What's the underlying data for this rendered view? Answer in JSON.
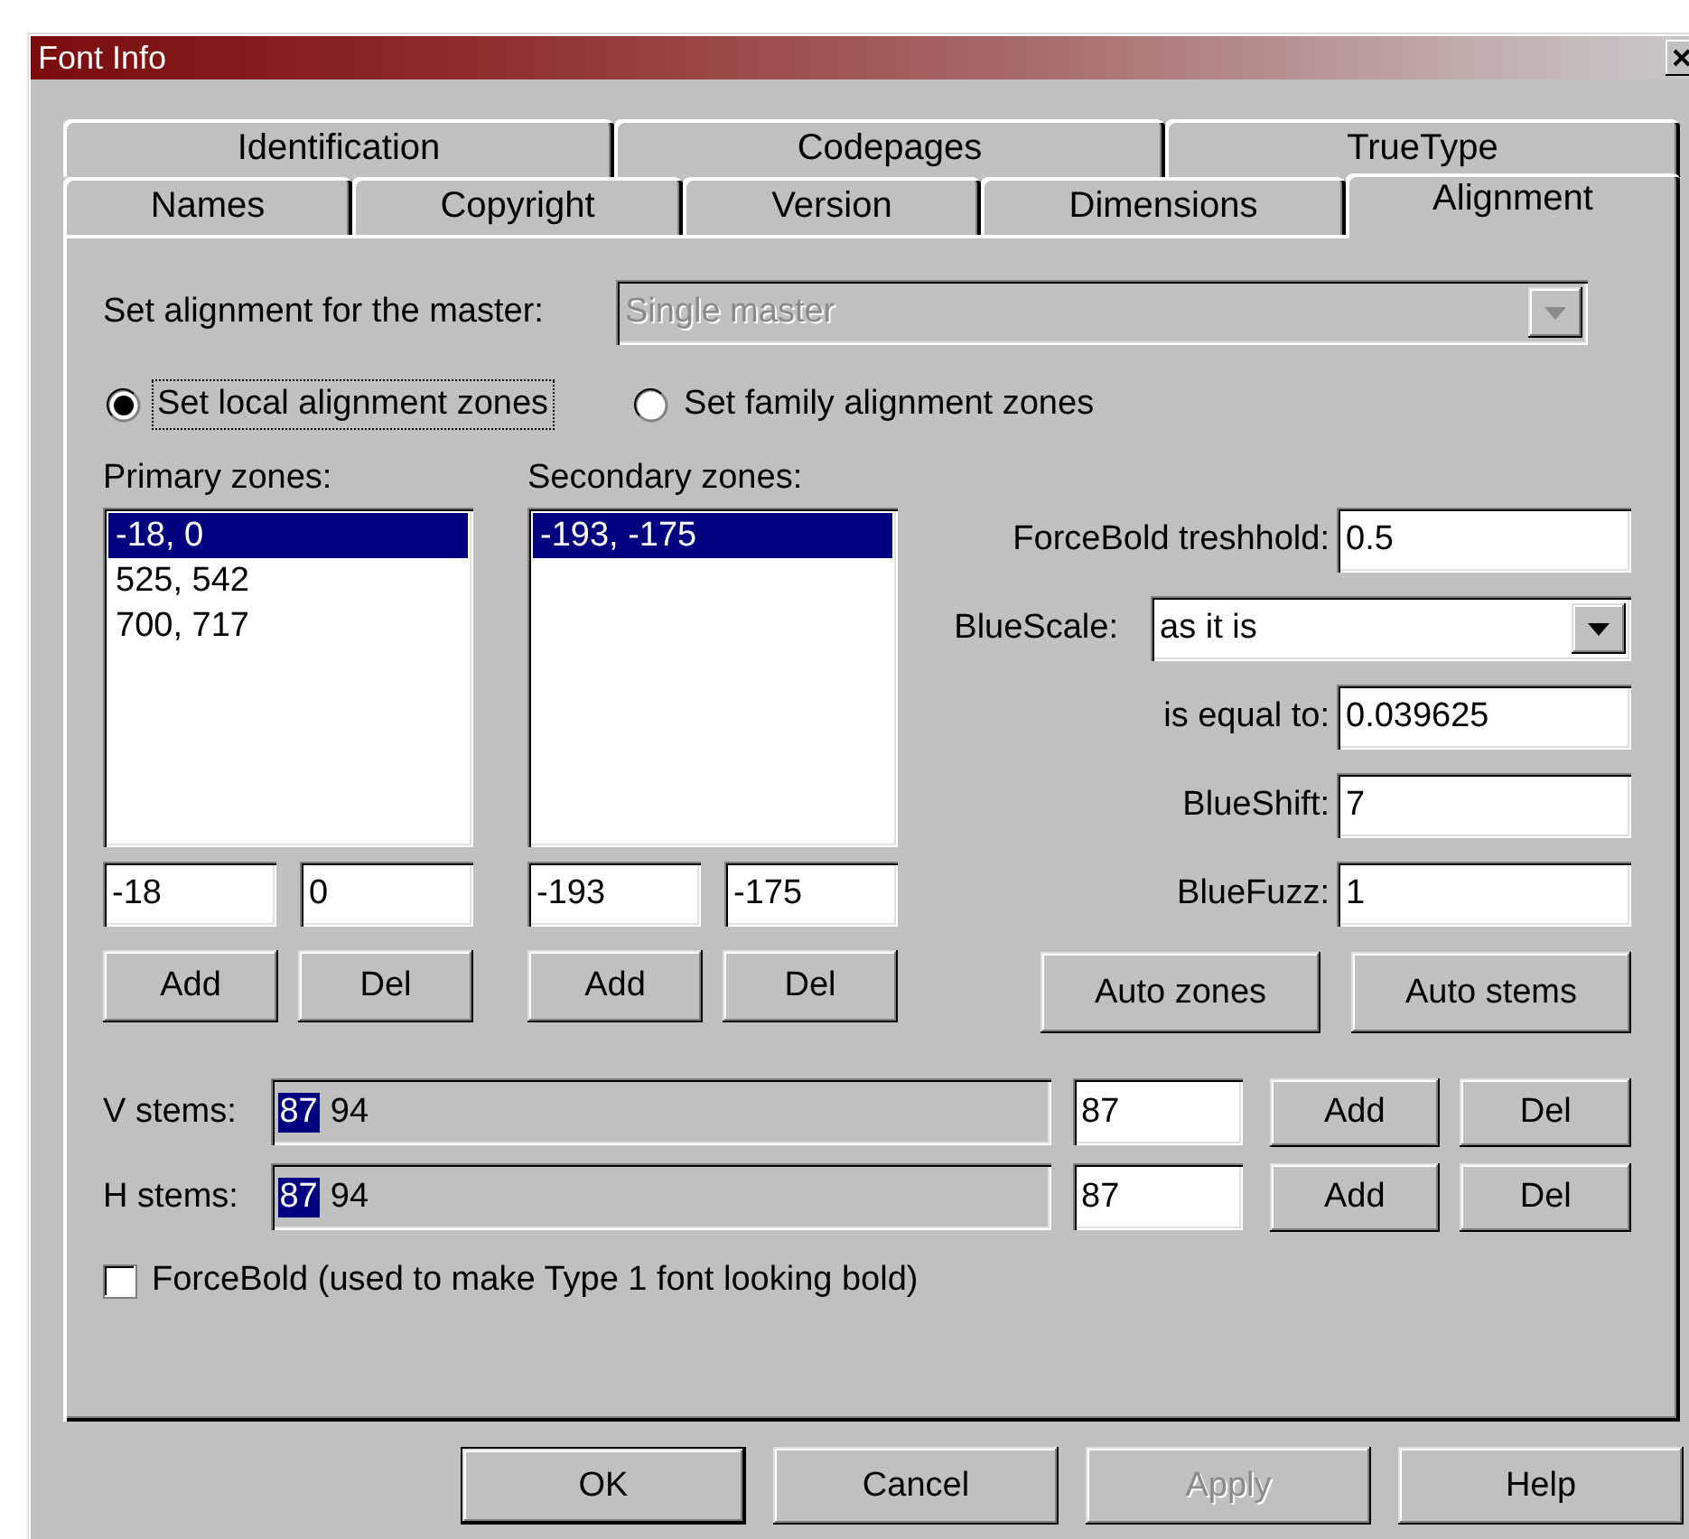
{
  "window": {
    "title": "Font Info"
  },
  "tab_rows": [
    {
      "tabs": [
        {
          "label": "Identification",
          "selected": false
        },
        {
          "label": "Codepages",
          "selected": false
        },
        {
          "label": "TrueType",
          "selected": false
        }
      ]
    },
    {
      "tabs": [
        {
          "label": "Names",
          "selected": false
        },
        {
          "label": "Copyright",
          "selected": false
        },
        {
          "label": "Version",
          "selected": false
        },
        {
          "label": "Dimensions",
          "selected": false
        },
        {
          "label": "Alignment",
          "selected": true
        }
      ]
    }
  ],
  "master": {
    "label": "Set alignment for the master:",
    "value": "Single master",
    "disabled": true
  },
  "zone_modes": [
    {
      "label": "Set local alignment zones",
      "selected": true,
      "focused": true
    },
    {
      "label": "Set family alignment zones",
      "selected": false,
      "focused": false
    }
  ],
  "zone_lists": [
    {
      "label": "Primary zones:",
      "items": [
        {
          "text": "-18, 0",
          "selected": true
        },
        {
          "text": "525, 542",
          "selected": false
        },
        {
          "text": "700, 717",
          "selected": false
        }
      ],
      "fields": [
        "-18",
        "0"
      ],
      "buttons": [
        "Add",
        "Del"
      ]
    },
    {
      "label": "Secondary zones:",
      "items": [
        {
          "text": "-193, -175",
          "selected": true
        }
      ],
      "fields": [
        "-193",
        "-175"
      ],
      "buttons": [
        "Add",
        "Del"
      ]
    }
  ],
  "parameters": [
    {
      "kind": "field",
      "label": "ForceBold treshhold:",
      "value": "0.5"
    },
    {
      "kind": "dropdown",
      "label": "BlueScale:",
      "value": "as it is"
    },
    {
      "kind": "field",
      "label": "is equal to:",
      "value": "0.039625"
    },
    {
      "kind": "field",
      "label": "BlueShift:",
      "value": "7"
    },
    {
      "kind": "field",
      "label": "BlueFuzz:",
      "value": "1"
    }
  ],
  "auto_buttons": [
    "Auto zones",
    "Auto stems"
  ],
  "stems": [
    {
      "label": "V stems:",
      "values": [
        {
          "text": "87",
          "selected": true
        },
        {
          "text": "94",
          "selected": false
        }
      ],
      "input": "87",
      "buttons": [
        "Add",
        "Del"
      ]
    },
    {
      "label": "H stems:",
      "values": [
        {
          "text": "87",
          "selected": true
        },
        {
          "text": "94",
          "selected": false
        }
      ],
      "input": "87",
      "buttons": [
        "Add",
        "Del"
      ]
    }
  ],
  "force_bold": {
    "label": "ForceBold (used to make Type 1 font looking bold)",
    "checked": false
  },
  "buttons": [
    {
      "label": "OK",
      "default": true,
      "disabled": false
    },
    {
      "label": "Cancel",
      "default": false,
      "disabled": false
    },
    {
      "label": "Apply",
      "default": false,
      "disabled": true
    },
    {
      "label": "Help",
      "default": false,
      "disabled": false
    }
  ]
}
